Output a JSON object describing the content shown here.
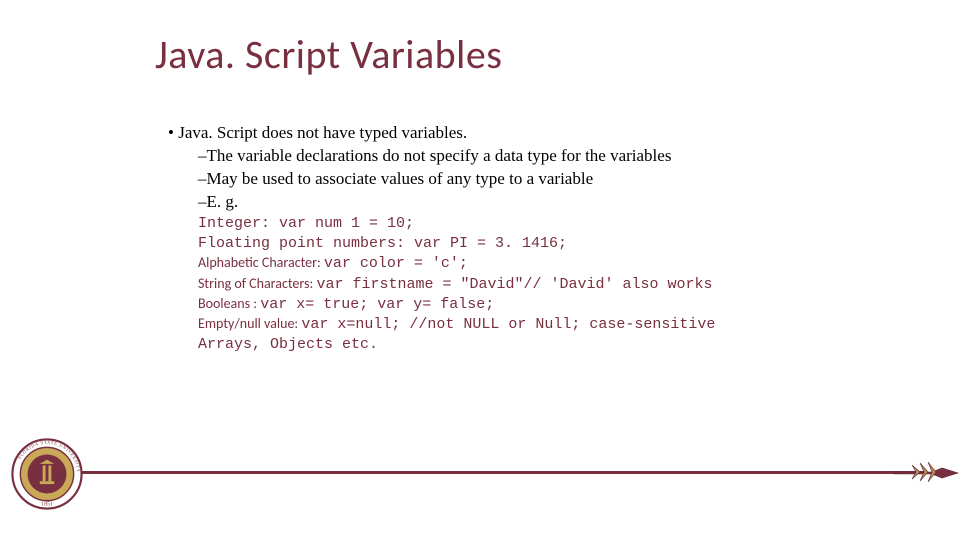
{
  "title": "Java. Script Variables",
  "bullets": {
    "main": "Java. Script does not have typed variables.",
    "sub1": "The variable declarations do not specify a data type for the variables",
    "sub2": "May be used to associate values of any type to a variable",
    "sub3": "E. g."
  },
  "examples": {
    "integer": "Integer: var num 1 = 10;",
    "float": "Floating point numbers: var PI = 3. 1416;",
    "char_label": "Alphabetic Character: ",
    "char_code": "var color = 'c';",
    "string_label": "String of Characters: ",
    "string_code": "var firstname = \"David\"// 'David' also works",
    "bool_label": "Booleans : ",
    "bool_code": "var x= true; var y= false;",
    "null_label": "Empty/null value: ",
    "null_code": "var x=null; //not NULL or Null; case-sensitive",
    "arrays": "Arrays, Objects etc."
  },
  "marks": {
    "dot": "• ",
    "dash": "–"
  },
  "seal": {
    "top": "FLORIDA STATE UNIVERSITY",
    "year": "1851"
  }
}
